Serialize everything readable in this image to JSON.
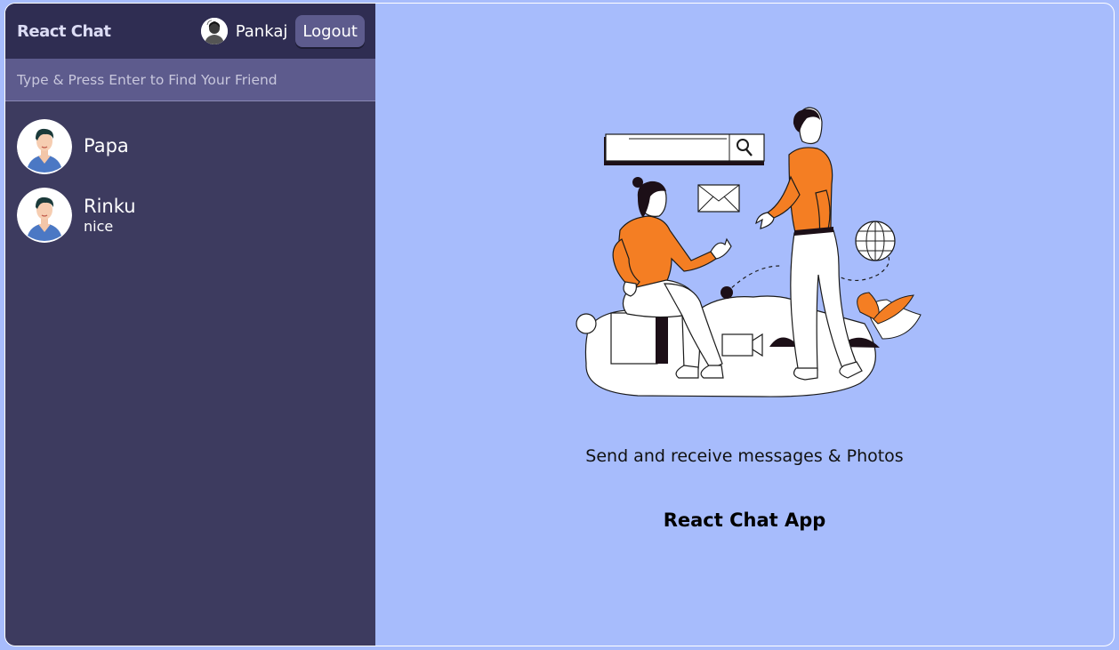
{
  "navbar": {
    "logo": "React Chat",
    "user_name": "Pankaj",
    "logout_label": "Logout",
    "avatar_icon": "user-avatar-icon"
  },
  "search": {
    "placeholder": "Type & Press Enter to Find Your Friend",
    "value": ""
  },
  "chats": [
    {
      "name": "Papa",
      "last_message": ""
    },
    {
      "name": "Rinku",
      "last_message": "nice"
    }
  ],
  "main": {
    "illustration_icon": "chat-people-illustration",
    "tagline": "Send and receive messages & Photos",
    "title": "React Chat App"
  },
  "colors": {
    "sidebar": "#3d3b5f",
    "navbar": "#2f2d52",
    "search": "#5d5b8d",
    "main_bg": "#a7bcfc",
    "accent_orange": "#f47e23"
  }
}
